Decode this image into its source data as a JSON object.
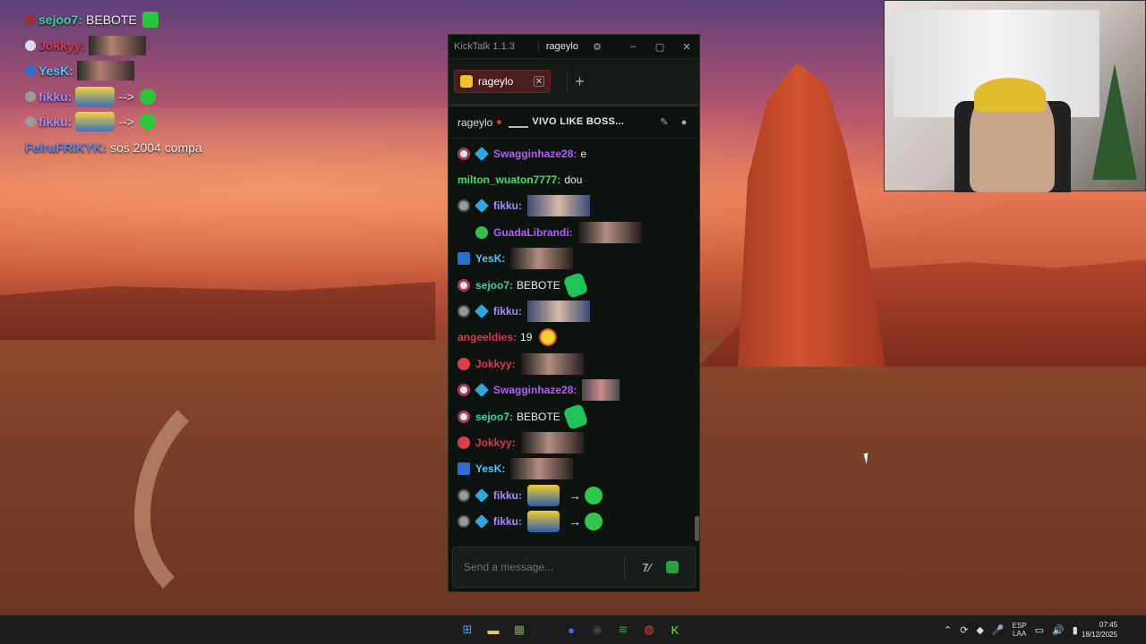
{
  "overlay": [
    {
      "user": "sejoo7:",
      "color": "#3fd1a5",
      "badge": "#9a2e3a",
      "text": "BEBOTE",
      "emote": "fox"
    },
    {
      "user": "Jokkyy:",
      "color": "#e0364b",
      "badge": "#d9d9ef",
      "text": "",
      "emote": "face"
    },
    {
      "user": "YesK:",
      "color": "#54c4ff",
      "badge": "#2a6fd1",
      "text": "",
      "emote": "face"
    },
    {
      "user": "fikku:",
      "color": "#a98bff",
      "badge": "#9a9a9a",
      "text": "-->",
      "emote": "minion"
    },
    {
      "user": "fikku:",
      "color": "#a98bff",
      "badge": "#9a9a9a",
      "text": "-->",
      "emote": "minion"
    },
    {
      "user": "FelruFRIKYK:",
      "color": "#4d8dff",
      "badge": "",
      "text": "sos 2004 compa",
      "emote": ""
    }
  ],
  "window": {
    "app_name": "KickTalk 1.1.3",
    "user": "rageylo",
    "tab_label": "rageylo",
    "channel_name": "rageylo",
    "stream_title": "VIVO LIKE BOSS...",
    "input_placeholder": "Send a message...",
    "icons": {
      "settings": "gear-icon",
      "minimize": "minimize-icon",
      "maximize": "maximize-icon",
      "close": "close-icon",
      "add_tab": "plus-icon",
      "pin": "pin-icon",
      "user": "user-icon"
    }
  },
  "messages": [
    {
      "user": "Swagginhaze28:",
      "color": "#b05cff",
      "badges": [
        "og",
        "cube"
      ],
      "text": "e",
      "emote": "",
      "indent": false
    },
    {
      "user": "milton_wuaton7777:",
      "color": "#3fe070",
      "badges": [],
      "text": "dou",
      "emote": "",
      "indent": false
    },
    {
      "user": "fikku:",
      "color": "#a98bff",
      "badges": [
        "sub",
        "cube"
      ],
      "text": "",
      "emote": "face",
      "indent": false
    },
    {
      "user": "GuadaLibrandi:",
      "color": "#b05cff",
      "badges": [
        "verified"
      ],
      "text": "",
      "emote": "plain",
      "indent": true
    },
    {
      "user": "YesK:",
      "color": "#54c4ff",
      "badges": [
        "mod"
      ],
      "text": "",
      "emote": "plain",
      "indent": false
    },
    {
      "user": "sejoo7:",
      "color": "#3fd1a5",
      "badges": [
        "og"
      ],
      "text": "BEBOTE",
      "emote": "fox",
      "indent": false
    },
    {
      "user": "fikku:",
      "color": "#a98bff",
      "badges": [
        "sub",
        "cube"
      ],
      "text": "",
      "emote": "face",
      "indent": false
    },
    {
      "user": "angeeldies:",
      "color": "#e0364b",
      "badges": [],
      "text": "19",
      "emote": "sun",
      "indent": false
    },
    {
      "user": "Jokkyy:",
      "color": "#e0364b",
      "badges": [
        "kick"
      ],
      "text": "",
      "emote": "plain",
      "indent": false
    },
    {
      "user": "Swagginhaze28:",
      "color": "#b05cff",
      "badges": [
        "og",
        "cube"
      ],
      "text": "",
      "emote": "pig",
      "indent": false
    },
    {
      "user": "sejoo7:",
      "color": "#3fd1a5",
      "badges": [
        "og"
      ],
      "text": "BEBOTE",
      "emote": "fox",
      "indent": false
    },
    {
      "user": "Jokkyy:",
      "color": "#e0364b",
      "badges": [
        "kick"
      ],
      "text": "",
      "emote": "plain",
      "indent": false
    },
    {
      "user": "YesK:",
      "color": "#54c4ff",
      "badges": [
        "mod"
      ],
      "text": "",
      "emote": "plain",
      "indent": false
    },
    {
      "user": "fikku:",
      "color": "#a98bff",
      "badges": [
        "sub",
        "cube"
      ],
      "text": "",
      "emote": "car",
      "arrow": "→",
      "indent": false
    },
    {
      "user": "fikku:",
      "color": "#a98bff",
      "badges": [
        "sub",
        "cube"
      ],
      "text": "",
      "emote": "car",
      "arrow": "→",
      "indent": false
    },
    {
      "user": "FelruFRIKYK:",
      "color": "#4d8dff",
      "badges": [],
      "text": "sos 2004 compa",
      "emote": "",
      "indent": false
    }
  ],
  "taskbar": {
    "apps": [
      "windows-start-icon",
      "file-explorer-icon",
      "minecraft-icon",
      "steam-icon",
      "discord-icon",
      "obs-icon",
      "spotify-icon",
      "chrome-icon",
      "kick-icon"
    ],
    "lang_top": "ESP",
    "lang_bottom": "LAA",
    "time": "07:45",
    "date": "18/12/2025"
  },
  "colors": {
    "accent": "#53fc18",
    "window_bg": "#0d130f",
    "tab_active": "#4a1d1d"
  }
}
